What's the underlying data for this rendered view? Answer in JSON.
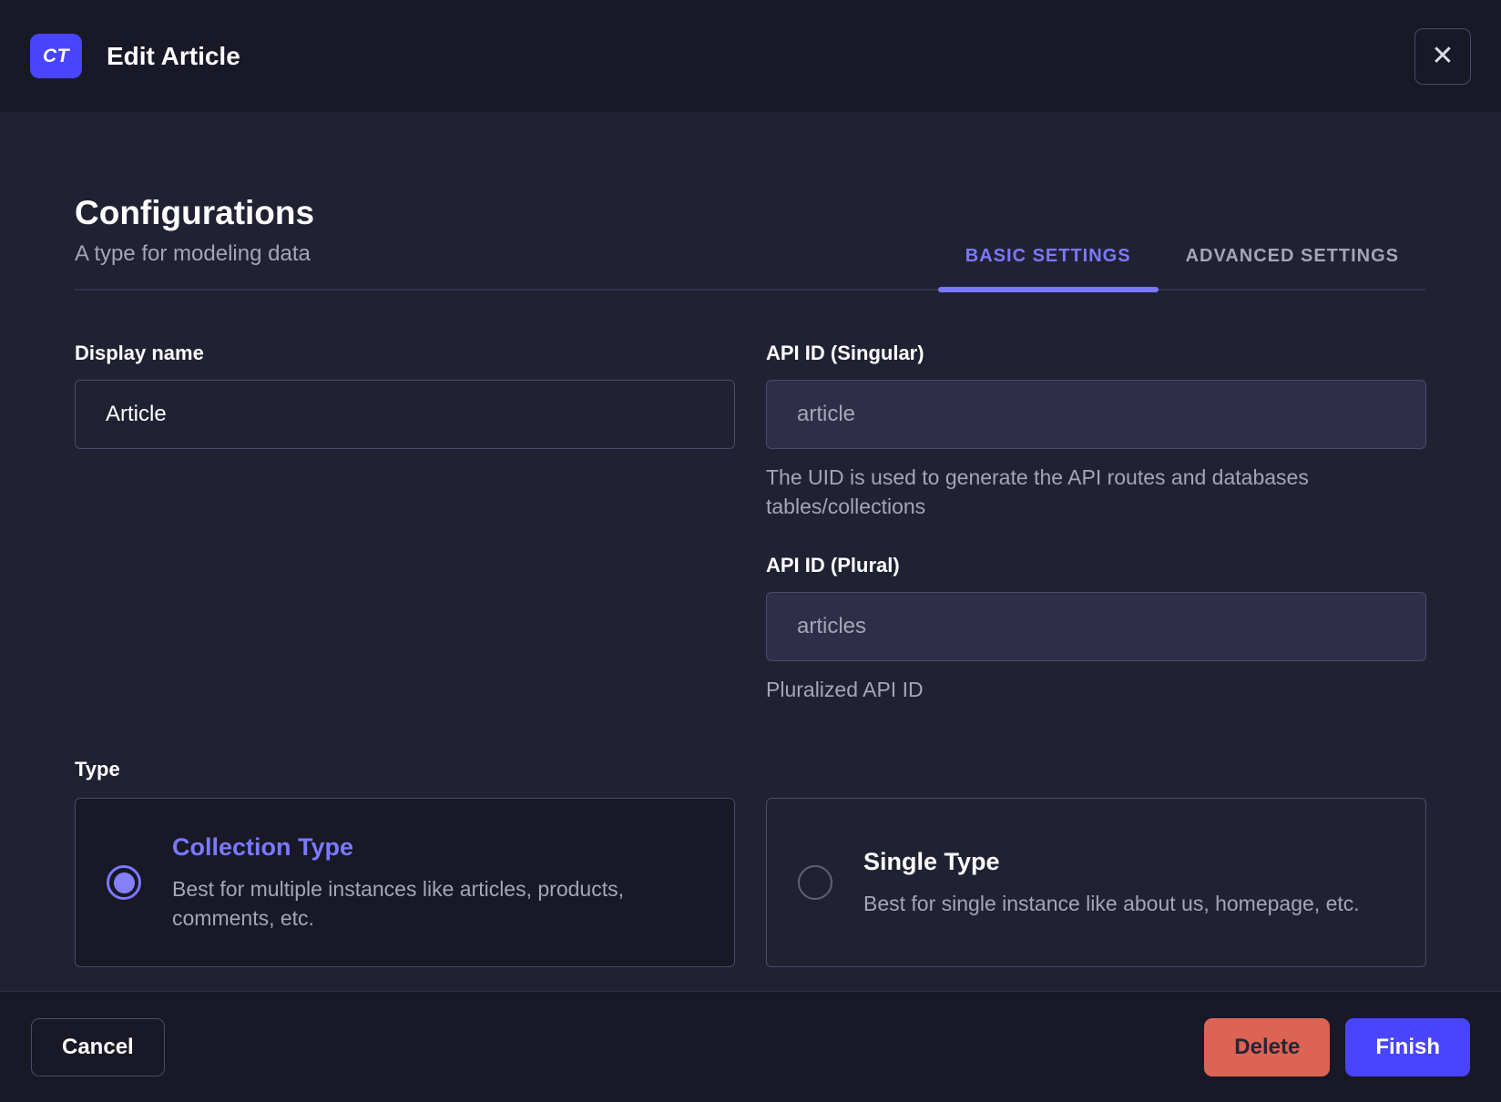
{
  "header": {
    "badge": "CT",
    "title": "Edit Article",
    "close_icon": "✕"
  },
  "config": {
    "title": "Configurations",
    "subtitle": "A type for modeling data",
    "tabs": [
      {
        "label": "BASIC SETTINGS",
        "active": true
      },
      {
        "label": "ADVANCED SETTINGS",
        "active": false
      }
    ]
  },
  "form": {
    "display_name": {
      "label": "Display name",
      "value": "Article"
    },
    "api_id_singular": {
      "label": "API ID (Singular)",
      "placeholder": "article",
      "helper": "The UID is used to generate the API routes and databases tables/collections"
    },
    "api_id_plural": {
      "label": "API ID (Plural)",
      "placeholder": "articles",
      "helper": "Pluralized API ID"
    },
    "type": {
      "label": "Type",
      "options": [
        {
          "title": "Collection Type",
          "description": "Best for multiple instances like articles, products, comments, etc.",
          "selected": true
        },
        {
          "title": "Single Type",
          "description": "Best for single instance like about us, homepage, etc.",
          "selected": false
        }
      ]
    }
  },
  "footer": {
    "cancel_label": "Cancel",
    "delete_label": "Delete",
    "finish_label": "Finish"
  },
  "colors": {
    "primary": "#4945ff",
    "primary_light": "#7b79ff",
    "danger": "#dd6355",
    "header_bg": "#181826",
    "body_bg": "#212134",
    "border": "#4a4a6a",
    "text_muted": "#a5a5ba"
  }
}
